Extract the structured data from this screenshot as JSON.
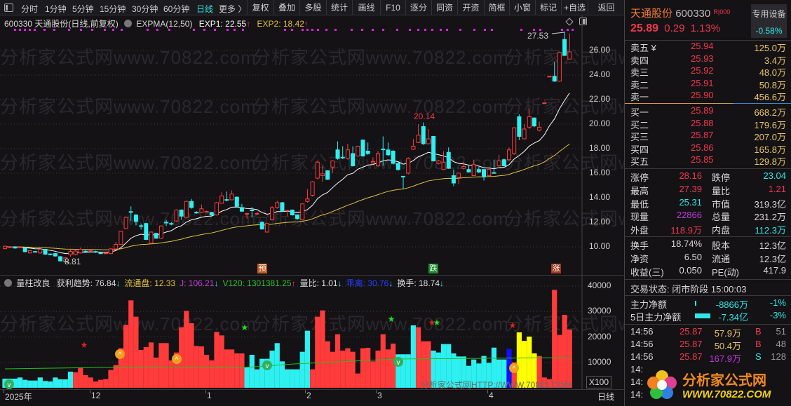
{
  "toolbar": {
    "periods": [
      "分时",
      "1分钟",
      "5分钟",
      "15分钟",
      "30分钟",
      "60分钟",
      "日线",
      "更多 〉"
    ],
    "buttons": [
      "复权",
      "叠加",
      "多股",
      "统计",
      "画线",
      "F10",
      "逐分",
      "同资",
      "开资",
      "简框",
      "小窗",
      "标记",
      "+自选",
      "返回"
    ]
  },
  "info": {
    "title": "600330 天通股份(日线,前复权)",
    "indicator": "EXPMA(12,50)",
    "exp1": "EXP1: 22.55",
    "exp2": "EXP2: 18.42",
    "up": "↑"
  },
  "watermark": "分析家公式网www.70822.com",
  "price_axis": [
    "26.00",
    "24.00",
    "22.00",
    "20.00",
    "18.00",
    "16.00",
    "14.00",
    "12.00",
    "10.00"
  ],
  "annotations": {
    "high": "27.53",
    "peak": "20.14",
    "low": "8.81"
  },
  "badges": [
    "预",
    "跌",
    "涨"
  ],
  "vol_info": {
    "name": "量柱改良",
    "items": [
      {
        "t": "获利趋势: 76.84",
        "a": "↓"
      },
      {
        "t": "流通盘: 12.33",
        "a": ""
      },
      {
        "t": "J: 106.21",
        "a": "↓"
      },
      {
        "t": "V120: 1301381.25",
        "a": "↑"
      },
      {
        "t": "量比: 1.01",
        "a": "↓"
      },
      {
        "t": "乖离: 30.76",
        "a": "↓"
      },
      {
        "t": "换手: 18.74",
        "a": "↓"
      }
    ]
  },
  "vol_axis": [
    "40000",
    "30000",
    "20000",
    "10000"
  ],
  "vol_unit": "X100",
  "vol_watermark": "分析家公式网HTTP://WWW.70822.COM",
  "date_axis": [
    "2025年",
    "12",
    "1",
    "2",
    "3",
    "4"
  ],
  "period_label": "日线",
  "colors": {
    "up": "#ff3b3b",
    "down": "#2ef0f0",
    "ema1": "#ffffff",
    "ema2": "#e0c040",
    "vol_line": "#22c022",
    "yellow": "#ffff00",
    "blue": "#1010ff"
  },
  "chart_data": {
    "type": "candlestick",
    "ema_periods": [
      12,
      50
    ],
    "ylim": [
      8,
      28
    ],
    "candles": [
      [
        9.85,
        10.05,
        10.1,
        9.8
      ],
      [
        9.95,
        10.0,
        10.05,
        9.9
      ],
      [
        10.0,
        9.9,
        10.05,
        9.85
      ],
      [
        9.95,
        9.98,
        10.05,
        9.9
      ],
      [
        9.9,
        9.6,
        9.95,
        9.55
      ],
      [
        9.5,
        9.7,
        9.75,
        9.45
      ],
      [
        9.62,
        9.58,
        9.65,
        9.55
      ],
      [
        9.5,
        9.8,
        9.82,
        9.45
      ],
      [
        9.8,
        9.4,
        9.82,
        9.35
      ],
      [
        9.42,
        9.38,
        9.45,
        9.3
      ],
      [
        9.45,
        9.25,
        9.5,
        9.2
      ],
      [
        9.2,
        8.85,
        9.25,
        8.81
      ],
      [
        9.0,
        9.1,
        9.15,
        8.95
      ],
      [
        9.35,
        9.63,
        9.8,
        9.2
      ],
      [
        9.35,
        9.65,
        9.75,
        9.3
      ],
      [
        9.5,
        9.8,
        9.95,
        9.45
      ],
      [
        9.65,
        9.6,
        9.72,
        9.5
      ],
      [
        9.65,
        9.68,
        9.72,
        9.6
      ],
      [
        9.62,
        9.58,
        9.68,
        9.5
      ],
      [
        9.5,
        9.48,
        9.55,
        9.45
      ],
      [
        9.45,
        9.5,
        9.55,
        9.4
      ],
      [
        9.45,
        9.83,
        9.9,
        9.4
      ],
      [
        9.83,
        10.2,
        10.4,
        9.8
      ],
      [
        10.2,
        11.26,
        11.3,
        10.15
      ],
      [
        11.5,
        12.4,
        12.45,
        11.45
      ],
      [
        12.87,
        12.85,
        13.3,
        12.1
      ],
      [
        12.6,
        12.07,
        12.65,
        11.75
      ],
      [
        11.72,
        11.68,
        11.9,
        11.4
      ],
      [
        11.9,
        10.6,
        11.95,
        10.55
      ],
      [
        10.3,
        11.2,
        11.25,
        10.25
      ],
      [
        11.1,
        10.7,
        11.15,
        10.65
      ],
      [
        10.7,
        11.7,
        11.75,
        10.65
      ],
      [
        12.0,
        11.98,
        12.2,
        11.7
      ],
      [
        11.9,
        11.88,
        12.0,
        11.75
      ],
      [
        12.1,
        13.0,
        13.05,
        12.05
      ],
      [
        13.0,
        12.5,
        13.05,
        12.2
      ],
      [
        12.4,
        13.7,
        13.75,
        12.35
      ],
      [
        13.7,
        13.2,
        13.9,
        13.1
      ],
      [
        12.82,
        12.78,
        12.9,
        12.7
      ],
      [
        12.8,
        13.1,
        13.45,
        12.75
      ],
      [
        12.85,
        12.88,
        12.95,
        12.8
      ],
      [
        12.8,
        12.6,
        12.85,
        12.55
      ],
      [
        12.6,
        13.6,
        13.65,
        12.55
      ],
      [
        13.55,
        14.15,
        14.45,
        13.5
      ],
      [
        13.85,
        13.8,
        14.5,
        13.7
      ],
      [
        13.83,
        14.3,
        14.6,
        13.8
      ],
      [
        14.05,
        13.3,
        14.1,
        13.2
      ],
      [
        13.2,
        12.9,
        13.5,
        12.85
      ],
      [
        12.68,
        12.72,
        12.75,
        12.3
      ],
      [
        13.0,
        12.98,
        13.25,
        12.4
      ],
      [
        12.68,
        12.72,
        12.8,
        12.6
      ],
      [
        12.0,
        11.45,
        12.1,
        11.4
      ],
      [
        11.2,
        11.9,
        11.95,
        11.2
      ],
      [
        12.2,
        13.2,
        13.3,
        12.15
      ],
      [
        13.2,
        13.6,
        13.75,
        13.1
      ],
      [
        13.6,
        12.9,
        13.65,
        12.85
      ],
      [
        12.93,
        12.97,
        13.0,
        12.5
      ],
      [
        13.0,
        12.6,
        13.05,
        12.55
      ],
      [
        12.6,
        12.3,
        12.65,
        12.2
      ],
      [
        12.2,
        13.5,
        13.55,
        12.15
      ],
      [
        13.7,
        13.9,
        14.7,
        13.6
      ],
      [
        14.2,
        15.3,
        15.35,
        14.1
      ],
      [
        15.6,
        16.9,
        17.0,
        15.5
      ],
      [
        15.8,
        15.95,
        16.6,
        15.3
      ],
      [
        16.2,
        15.5,
        16.25,
        15.45
      ],
      [
        16.5,
        17.0,
        17.05,
        16.0
      ],
      [
        17.9,
        17.2,
        18.6,
        17.1
      ],
      [
        17.3,
        17.25,
        18.2,
        17.15
      ],
      [
        17.2,
        17.9,
        18.4,
        17.1
      ],
      [
        17.6,
        16.6,
        18.2,
        16.55
      ],
      [
        17.4,
        18.2,
        18.25,
        17.35
      ],
      [
        18.7,
        17.4,
        18.75,
        17.35
      ],
      [
        17.8,
        17.6,
        18.5,
        17.5
      ],
      [
        16.85,
        16.95,
        17.3,
        16.7
      ],
      [
        16.6,
        17.6,
        17.8,
        16.5
      ],
      [
        17.97,
        17.93,
        19.0,
        16.6
      ],
      [
        17.9,
        17.5,
        18.5,
        17.4
      ],
      [
        17.8,
        16.8,
        17.9,
        16.7
      ],
      [
        16.8,
        16.3,
        16.9,
        16.2
      ],
      [
        15.75,
        15.7,
        15.75,
        14.7
      ],
      [
        16.0,
        17.2,
        17.3,
        15.9
      ],
      [
        17.95,
        18.2,
        18.8,
        17.9
      ],
      [
        18.5,
        19.1,
        20.0,
        18.45
      ],
      [
        19.8,
        18.4,
        20.14,
        18.3
      ],
      [
        18.4,
        18.8,
        19.6,
        18.35
      ],
      [
        19.0,
        17.0,
        19.05,
        16.95
      ],
      [
        16.8,
        17.0,
        17.1,
        16.7
      ],
      [
        16.3,
        16.9,
        17.8,
        16.25
      ],
      [
        17.7,
        16.4,
        18.1,
        16.35
      ],
      [
        15.8,
        15.2,
        16.3,
        14.95
      ],
      [
        15.65,
        16.0,
        16.05,
        15.1
      ],
      [
        16.4,
        16.55,
        16.9,
        16.3
      ],
      [
        16.3,
        16.1,
        16.6,
        16.05
      ],
      [
        15.8,
        16.7,
        17.1,
        15.75
      ],
      [
        16.3,
        16.1,
        16.5,
        16.0
      ],
      [
        16.3,
        15.7,
        16.35,
        15.4
      ],
      [
        15.8,
        16.3,
        16.35,
        15.75
      ],
      [
        16.05,
        16.0,
        17.1,
        15.95
      ],
      [
        16.6,
        17.0,
        17.5,
        16.5
      ],
      [
        17.1,
        16.6,
        17.2,
        16.55
      ],
      [
        17.1,
        17.9,
        18.1,
        17.0
      ],
      [
        17.6,
        19.7,
        19.75,
        17.5
      ],
      [
        20.6,
        19.0,
        20.8,
        18.7
      ],
      [
        18.8,
        19.6,
        20.0,
        18.75
      ],
      [
        19.75,
        20.6,
        21.3,
        19.6
      ],
      [
        20.5,
        19.85,
        20.55,
        19.75
      ],
      [
        19.5,
        19.75,
        20.2,
        19.4
      ],
      [
        21.73,
        21.73,
        21.73,
        21.73
      ],
      [
        23.9,
        23.9,
        23.9,
        23.9
      ],
      [
        23.9,
        23.5,
        25.1,
        23.45
      ],
      [
        23.5,
        25.85,
        25.9,
        23.45
      ],
      [
        26.9,
        25.6,
        27.53,
        25.55
      ],
      [
        25.3,
        25.89,
        27.39,
        25.31
      ]
    ],
    "volume": [
      3590,
      3590,
      3590,
      4050,
      3130,
      2850,
      2850,
      4050,
      2670,
      2480,
      4050,
      3310,
      3310,
      6340,
      6070,
      7990,
      4970,
      4050,
      2480,
      3130,
      3400,
      6990,
      8920,
      15540,
      24740,
      34400,
      27960,
      14900,
      16000,
      17840,
      11860,
      17570,
      17570,
      10760,
      13880,
      23820,
      30260,
      25380,
      16460,
      16280,
      12970,
      10760,
      21980,
      20600,
      15080,
      15080,
      13520,
      13520,
      8180,
      12970,
      7260,
      11400,
      11400,
      14620,
      17570,
      10390,
      7260,
      7260,
      7260,
      14160,
      22440,
      7260,
      27960,
      30440,
      18300,
      14160,
      21060,
      14620,
      15540,
      14160,
      5610,
      15540,
      15730,
      10390,
      14620,
      21060,
      15080,
      17390,
      13170,
      13170,
      13170,
      24560,
      23820,
      18300,
      18300,
      14620,
      13880,
      17200,
      17200,
      13520,
      12310,
      12310,
      8640,
      11130,
      9560,
      12500,
      9830,
      15800,
      11130,
      11130,
      15270,
      10020,
      21800,
      18480,
      20140,
      13520,
      12500,
      4050,
      3400,
      38530,
      20790,
      28690,
      22900
    ],
    "volume_color_runs": [
      [
        "c",
        14
      ],
      [
        "r",
        34
      ],
      [
        "c",
        13
      ],
      [
        "r",
        17
      ],
      [
        "c",
        4
      ],
      [
        "r",
        3
      ],
      [
        "c",
        15
      ],
      [
        "b",
        1
      ],
      [
        "r",
        1
      ],
      [
        "y",
        4
      ],
      [
        "r",
        7
      ]
    ],
    "vol_ylim": [
      0,
      40000
    ]
  },
  "quote": {
    "name": "天通股份",
    "code": "600330",
    "tag": "R|000",
    "price": "25.89",
    "change": "0.29",
    "pct": "1.13%",
    "sector": "专用设备",
    "sector_pct": "-0.58%"
  },
  "asks": [
    {
      "l": "卖五 ¥",
      "p": "25.94",
      "v": "125.0万"
    },
    {
      "l": "卖四",
      "p": "25.93",
      "v": "3.4万"
    },
    {
      "l": "卖三",
      "p": "25.92",
      "v": "48.0万"
    },
    {
      "l": "卖二",
      "p": "25.91",
      "v": "50.8万"
    },
    {
      "l": "卖一",
      "p": "25.90",
      "v": "456.6万"
    }
  ],
  "bids": [
    {
      "l": "买一",
      "p": "25.89",
      "v": "668.2万"
    },
    {
      "l": "买二",
      "p": "25.88",
      "v": "179.6万"
    },
    {
      "l": "买三",
      "p": "25.87",
      "v": "207.0万"
    },
    {
      "l": "买四",
      "p": "25.86",
      "v": "165.8万"
    },
    {
      "l": "买五",
      "p": "25.85",
      "v": "129.8万"
    }
  ],
  "stats": [
    {
      "l1": "涨停",
      "v1": "28.16",
      "c1": "red",
      "l2": "跌停",
      "v2": "23.04",
      "c2": "cyan"
    },
    {
      "l1": "最高",
      "v1": "27.39",
      "c1": "red",
      "l2": "量比",
      "v2": "1.21",
      "c2": "red"
    },
    {
      "l1": "最低",
      "v1": "25.31",
      "c1": "cyan",
      "l2": "市值",
      "v2": "319.3亿",
      "c2": "wht"
    },
    {
      "l1": "现量",
      "v1": "22866",
      "c1": "mag",
      "l2": "总量",
      "v2": "231.2万",
      "c2": "wht"
    },
    {
      "l1": "外盘",
      "v1": "118.9万",
      "c1": "red",
      "l2": "内盘",
      "v2": "112.3万",
      "c2": "cyan"
    }
  ],
  "stats2": [
    {
      "l1": "换手",
      "v1": "18.74%",
      "l2": "股本",
      "v2": "12.3亿"
    },
    {
      "l1": "净资",
      "v1": "6.50",
      "l2": "流通",
      "v2": "12.3亿"
    },
    {
      "l1": "收益(三)",
      "v1": "0.050",
      "l2": "PE(动)",
      "v2": "417.9"
    }
  ],
  "status": "交易状态: 闭市阶段 15:00:03",
  "flow": [
    {
      "l": "主力净额",
      "v": "-8866万",
      "p": "-1%"
    },
    {
      "l": "5日主力净额",
      "v": "-7.34亿",
      "p": "-3%"
    }
  ],
  "ticks": [
    {
      "t": "14:56",
      "p": "25.87",
      "v": "57.9万",
      "s": "B",
      "n": "51"
    },
    {
      "t": "14:56",
      "p": "25.87",
      "v": "50.4万",
      "s": "B",
      "n": "48"
    },
    {
      "t": "14:56",
      "p": "25.87",
      "v": "167.9万",
      "s": "S",
      "n": "128"
    },
    {
      "t": "14:"
    },
    {
      "t": "14:"
    },
    {
      "t": "14:"
    }
  ],
  "logo": {
    "name": "分析家公式网",
    "url": "WWW.70822.COM"
  }
}
